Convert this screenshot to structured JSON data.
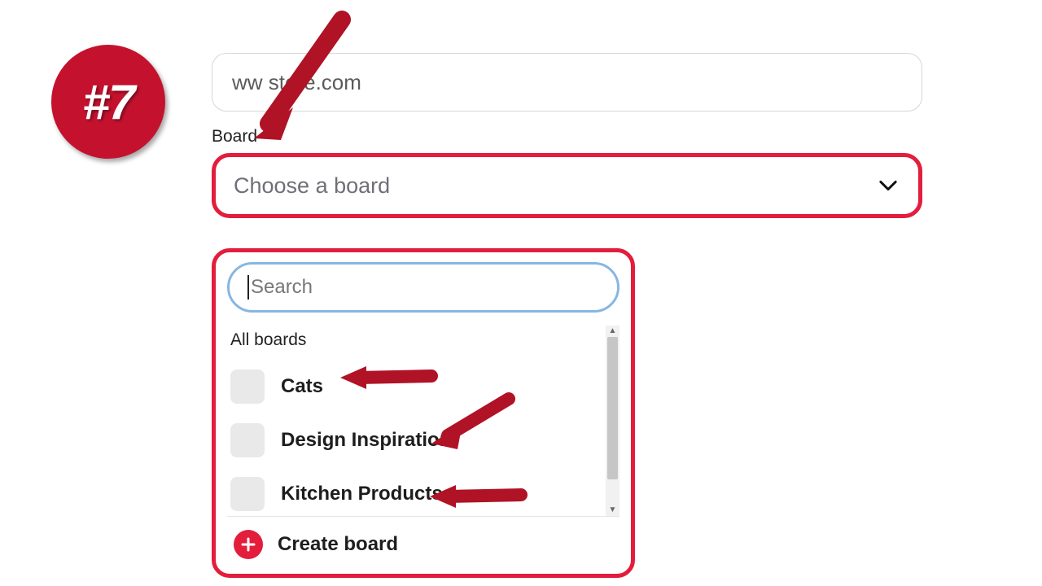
{
  "badge": {
    "text": "#7"
  },
  "url_field": {
    "value_visible": "ww       store.com"
  },
  "board_label": "Board",
  "board_select": {
    "placeholder": "Choose a board"
  },
  "popover": {
    "search": {
      "placeholder": "Search"
    },
    "section_title": "All boards",
    "boards": [
      {
        "name": "Cats"
      },
      {
        "name": "Design Inspiration"
      },
      {
        "name": "Kitchen Products"
      }
    ],
    "create_label": "Create board"
  },
  "colors": {
    "accent": "#e31d3b",
    "badge_bg": "#c4122e",
    "search_outline": "#86b7e2"
  }
}
